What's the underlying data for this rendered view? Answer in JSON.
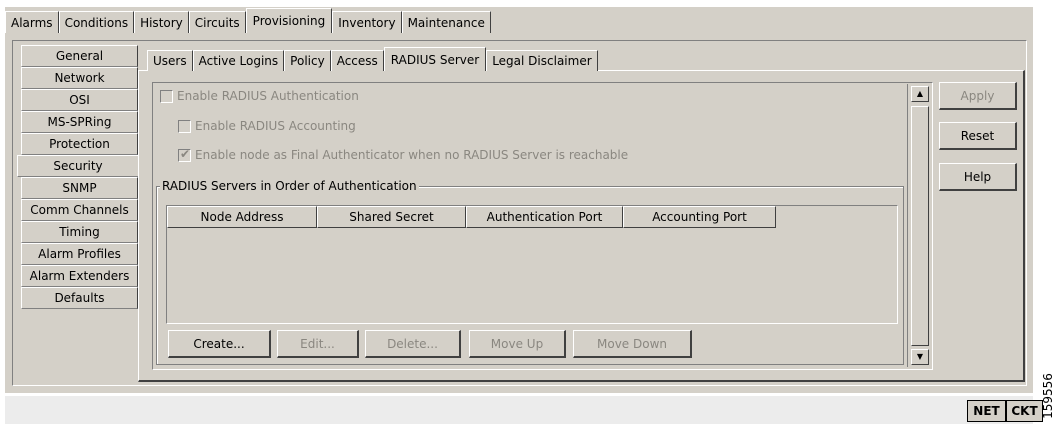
{
  "top_tabs": [
    "Alarms",
    "Conditions",
    "History",
    "Circuits",
    "Provisioning",
    "Inventory",
    "Maintenance"
  ],
  "top_tabs_active": "Provisioning",
  "side_nav": [
    "General",
    "Network",
    "OSI",
    "MS-SPRing",
    "Protection",
    "Security",
    "SNMP",
    "Comm Channels",
    "Timing",
    "Alarm Profiles",
    "Alarm Extenders",
    "Defaults"
  ],
  "side_nav_selected": "Security",
  "sub_tabs": [
    "Users",
    "Active Logins",
    "Policy",
    "Access",
    "RADIUS Server",
    "Legal Disclaimer"
  ],
  "sub_tabs_active": "RADIUS Server",
  "options": {
    "enable_auth": {
      "label": "Enable RADIUS Authentication",
      "checked": false
    },
    "enable_accounting": {
      "label": "Enable RADIUS Accounting",
      "checked": false
    },
    "final_auth": {
      "label": "Enable node as Final Authenticator when no RADIUS Server is reachable",
      "checked": true
    }
  },
  "servers_group": {
    "title": "RADIUS Servers in Order of Authentication",
    "columns": [
      "Node Address",
      "Shared Secret",
      "Authentication Port",
      "Accounting Port"
    ],
    "rows": []
  },
  "list_buttons": {
    "create": "Create...",
    "edit": "Edit...",
    "delete": "Delete...",
    "move_up": "Move Up",
    "move_down": "Move Down"
  },
  "side_buttons": {
    "apply": "Apply",
    "reset": "Reset",
    "help": "Help"
  },
  "status_bar": {
    "net": "NET",
    "ckt": "CKT"
  },
  "figure_id": "159556"
}
